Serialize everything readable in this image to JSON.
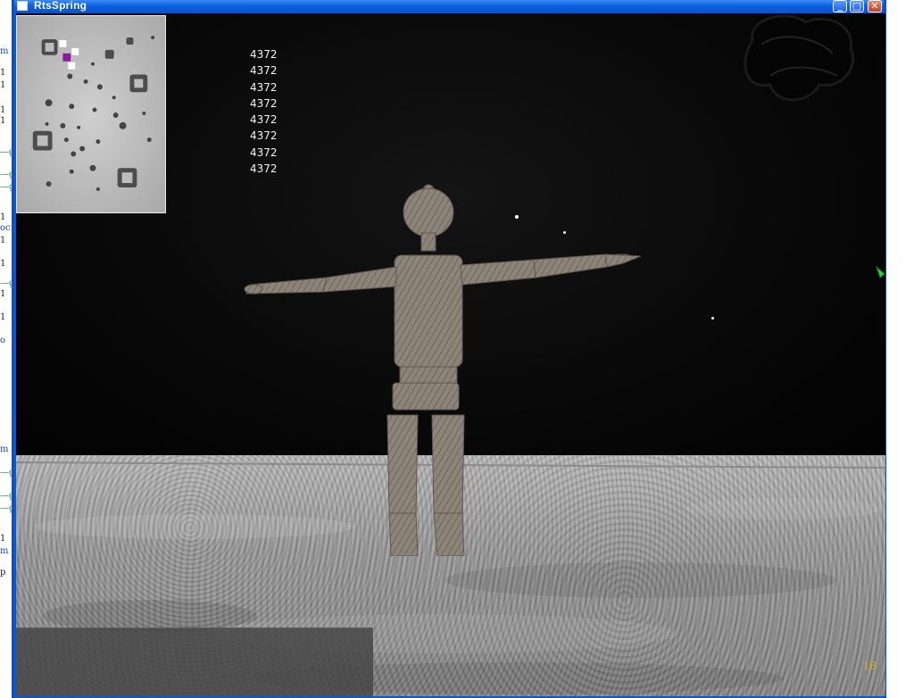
{
  "window": {
    "title": "RtsSpring",
    "minimize_glyph": "_",
    "maximize_glyph": "□",
    "close_glyph": "✕"
  },
  "background_editor": {
    "lines": [
      {
        "text": "m",
        "color": "blue"
      },
      {
        "text": "1",
        "color": "dark"
      },
      {
        "text": "1",
        "color": "dark"
      },
      {
        "text": "1",
        "color": "dark"
      },
      {
        "text": "1",
        "color": "dark"
      },
      {
        "text": "—g",
        "color": "green"
      },
      {
        "text": "—g",
        "color": "green"
      },
      {
        "text": "—g",
        "color": "green"
      },
      {
        "text": "1",
        "color": "dark"
      },
      {
        "text": "oc",
        "color": "blue"
      },
      {
        "text": "1",
        "color": "dark"
      },
      {
        "text": "1",
        "color": "dark"
      },
      {
        "text": "—g",
        "color": "green"
      },
      {
        "text": "1",
        "color": "dark"
      },
      {
        "text": "1",
        "color": "dark"
      },
      {
        "text": "o",
        "color": "blue"
      },
      {
        "text": "m",
        "color": "blue"
      },
      {
        "text": "—g",
        "color": "green"
      },
      {
        "text": "—g",
        "color": "green"
      },
      {
        "text": "—g",
        "color": "green"
      },
      {
        "text": "1",
        "color": "dark"
      },
      {
        "text": "m",
        "color": "blue"
      },
      {
        "text": "p",
        "color": "dark"
      }
    ]
  },
  "hud": {
    "stat_lines": [
      "4372",
      "4372",
      "4372",
      "4372",
      "4372",
      "4372",
      "4372",
      "4372"
    ],
    "frame_counter": "18"
  },
  "colors": {
    "titlebar": "#0a5fe0",
    "sky": "#050505",
    "ground": "#a3a3a3",
    "figure": "#8a8177",
    "minimap_unit_selected": "#8a1a9a",
    "frame_counter": "#c9b21f"
  },
  "icons": {
    "app": "window-icon",
    "minimize": "minimize-icon",
    "maximize": "maximize-icon",
    "close": "close-icon"
  }
}
